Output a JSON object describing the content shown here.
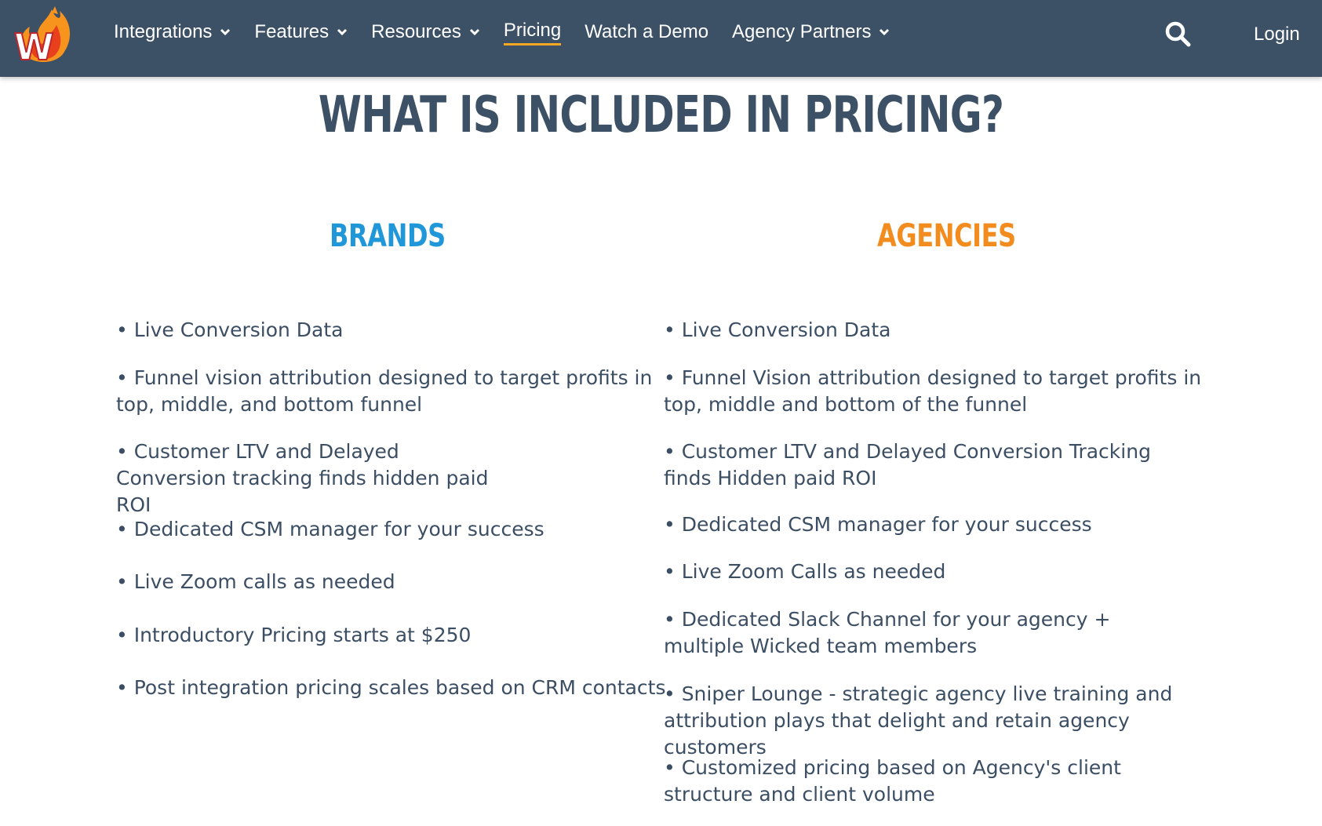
{
  "colors": {
    "nav_bg": "#3d5166",
    "title": "#3d5166",
    "brands_accent": "#1f97d8",
    "agencies_accent": "#f28c1e",
    "active_underline": "#f5a623"
  },
  "logo": {
    "letter": "W"
  },
  "nav": {
    "items": [
      {
        "label": "Integrations",
        "icon": "chevron-down-icon"
      },
      {
        "label": "Features",
        "icon": "chevron-down-icon"
      },
      {
        "label": "Resources",
        "icon": "chevron-down-icon"
      },
      {
        "label": "Pricing",
        "active": true
      },
      {
        "label": "Watch a Demo"
      },
      {
        "label": "Agency Partners",
        "icon": "chevron-down-icon"
      }
    ],
    "search_icon": "search-icon",
    "login": "Login"
  },
  "main": {
    "title": "WHAT IS INCLUDED IN PRICING?",
    "brands": {
      "heading": "BRANDS",
      "items": [
        "• Live Conversion Data",
        "• Funnel vision attribution designed to target profits in top, middle, and bottom funnel",
        "• Customer LTV and Delayed Conversion tracking finds hidden paid ROI",
        "• Dedicated CSM manager for your success",
        "• Live Zoom calls as needed",
        "• Introductory Pricing starts at $250",
        "• Post integration pricing scales based on CRM contacts"
      ]
    },
    "agencies": {
      "heading": "AGENCIES",
      "items": [
        "• Live Conversion Data",
        "• Funnel Vision attribution designed to target profits in top, middle and bottom of the funnel",
        "• Customer LTV and Delayed Conversion Tracking finds Hidden paid ROI",
        "• Dedicated CSM manager for your success",
        "• Live Zoom Calls as needed",
        "• Dedicated Slack Channel for your agency + multiple Wicked team members",
        "• Sniper Lounge - strategic agency live training and attribution plays that delight and retain agency customers",
        "• Customized pricing based on Agency's client structure and client volume"
      ]
    }
  }
}
